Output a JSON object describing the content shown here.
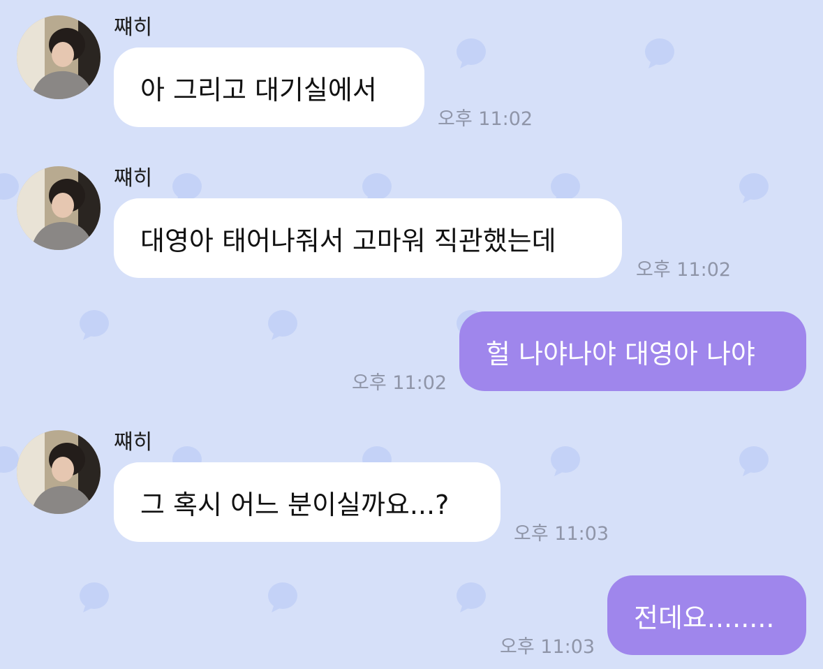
{
  "theme": {
    "background": "#d6e0f9",
    "pattern_icon": "chat-bubble-icon",
    "pattern_color": "#c4d2f7",
    "incoming_bubble": "#ffffff",
    "outgoing_bubble": "#9f86ec",
    "time_color": "#8f95a8"
  },
  "messages": [
    {
      "direction": "incoming",
      "sender": "쨰히",
      "avatar": "avatar-photo",
      "text": "아 그리고 대기실에서",
      "time": "오후 11:02"
    },
    {
      "direction": "incoming",
      "sender": "쨰히",
      "avatar": "avatar-photo",
      "text": "대영아 태어나줘서 고마워 직관했는데",
      "time": "오후 11:02"
    },
    {
      "direction": "outgoing",
      "text": "헐 나야나야 대영아 나야",
      "time": "오후 11:02"
    },
    {
      "direction": "incoming",
      "sender": "쨰히",
      "avatar": "avatar-photo",
      "text": "그 혹시 어느 분이실까요...?",
      "time": "오후 11:03"
    },
    {
      "direction": "outgoing",
      "text": "전데요........",
      "time": "오후 11:03"
    }
  ]
}
